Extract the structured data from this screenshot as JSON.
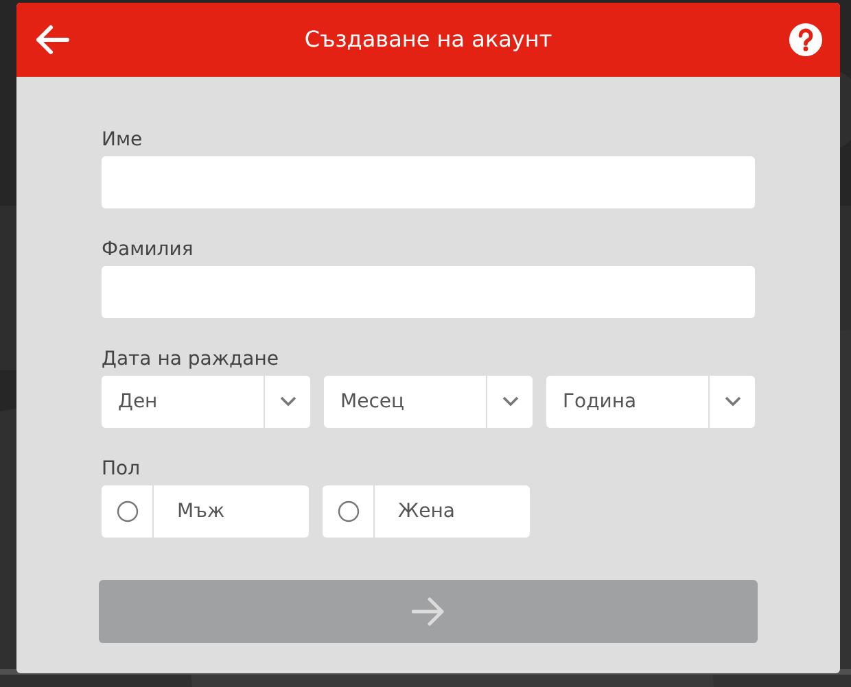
{
  "header": {
    "title": "Създаване на акаунт"
  },
  "fields": [
    {
      "label": "Име"
    },
    {
      "label": "Фамилия"
    }
  ],
  "birth_date": {
    "label": "Дата на раждане",
    "selects": [
      {
        "placeholder": "Ден"
      },
      {
        "placeholder": "Месец"
      },
      {
        "placeholder": "Година"
      }
    ]
  },
  "gender": {
    "label": "Пол",
    "options": [
      {
        "label": "Мъж",
        "selected": false
      },
      {
        "label": "Жена",
        "selected": false
      }
    ]
  },
  "submit": {
    "disabled": true
  }
}
